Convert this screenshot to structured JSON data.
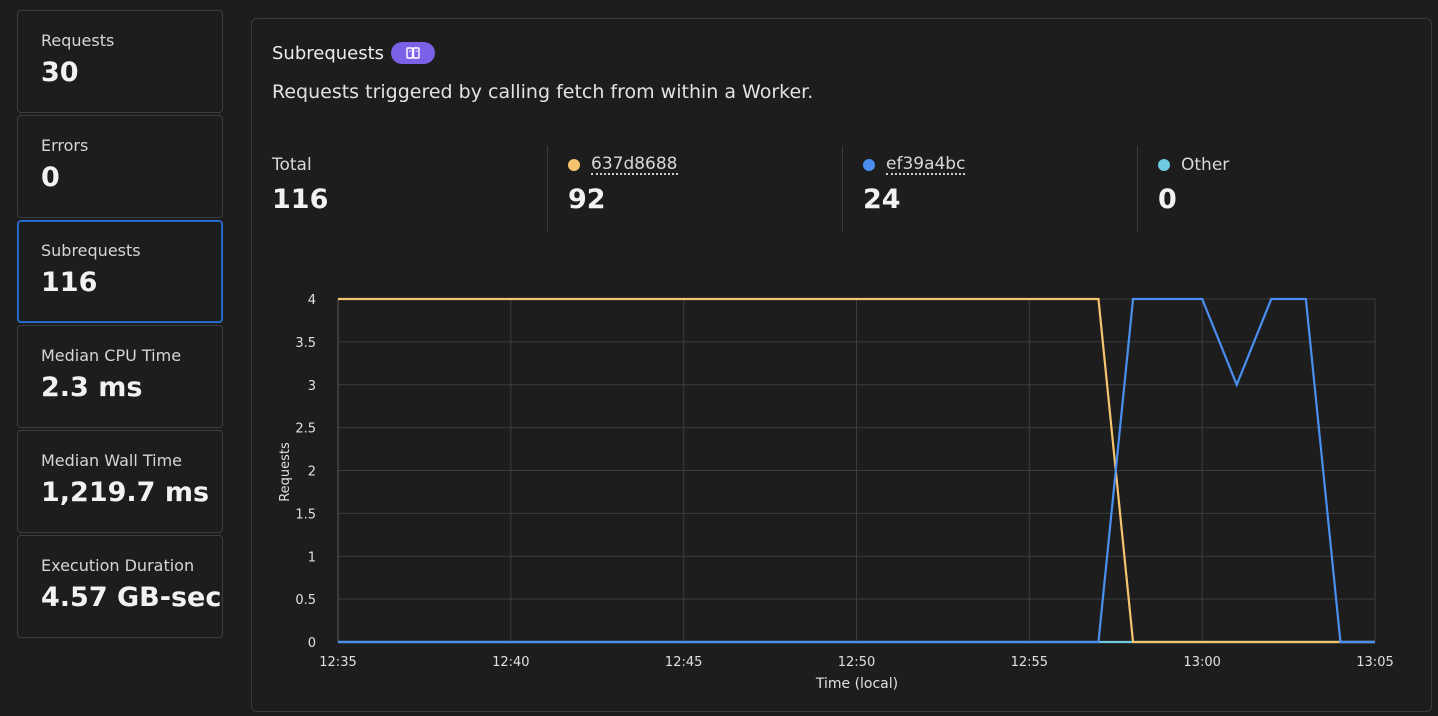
{
  "sidebar": {
    "cards": [
      {
        "label": "Requests",
        "value": "30"
      },
      {
        "label": "Errors",
        "value": "0"
      },
      {
        "label": "Subrequests",
        "value": "116"
      },
      {
        "label": "Median CPU Time",
        "value": "2.3 ms"
      },
      {
        "label": "Median Wall Time",
        "value": "1,219.7 ms"
      },
      {
        "label": "Execution Duration",
        "value": "4.57 GB-sec"
      }
    ],
    "selected_index": 2
  },
  "panel": {
    "title": "Subrequests",
    "badge_icon": "book-icon",
    "description": "Requests triggered by calling fetch from within a Worker."
  },
  "stats": {
    "total": {
      "label": "Total",
      "value": "116"
    },
    "series1": {
      "label": "637d8688",
      "value": "92",
      "color": "#f5c46e"
    },
    "series2": {
      "label": "ef39a4bc",
      "value": "24",
      "color": "#4a8ff0"
    },
    "other": {
      "label": "Other",
      "value": "0",
      "color": "#6fcadf"
    }
  },
  "chart_data": {
    "type": "line",
    "xlabel": "Time (local)",
    "ylabel": "Requests",
    "ylim": [
      0,
      4
    ],
    "yticks": [
      "0",
      "0.5",
      "1",
      "1.5",
      "2",
      "2.5",
      "3",
      "3.5",
      "4"
    ],
    "xticks": [
      "12:35",
      "12:40",
      "12:45",
      "12:50",
      "12:55",
      "13:00",
      "13:05"
    ],
    "grid": true,
    "series": [
      {
        "name": "637d8688",
        "color": "#f5c46e",
        "points": [
          [
            "12:35",
            4
          ],
          [
            "12:57",
            4
          ],
          [
            "12:58",
            0
          ],
          [
            "13:05",
            0
          ]
        ]
      },
      {
        "name": "ef39a4bc",
        "color": "#4a8ff0",
        "points": [
          [
            "12:35",
            0
          ],
          [
            "12:57",
            0
          ],
          [
            "12:58",
            4
          ],
          [
            "13:00",
            4
          ],
          [
            "13:01",
            3
          ],
          [
            "13:02",
            4
          ],
          [
            "13:03",
            4
          ],
          [
            "13:04",
            0
          ],
          [
            "13:05",
            0
          ]
        ]
      },
      {
        "name": "Other",
        "color": "#6fcadf",
        "points": [
          [
            "12:35",
            0
          ],
          [
            "13:05",
            0
          ]
        ]
      }
    ]
  }
}
